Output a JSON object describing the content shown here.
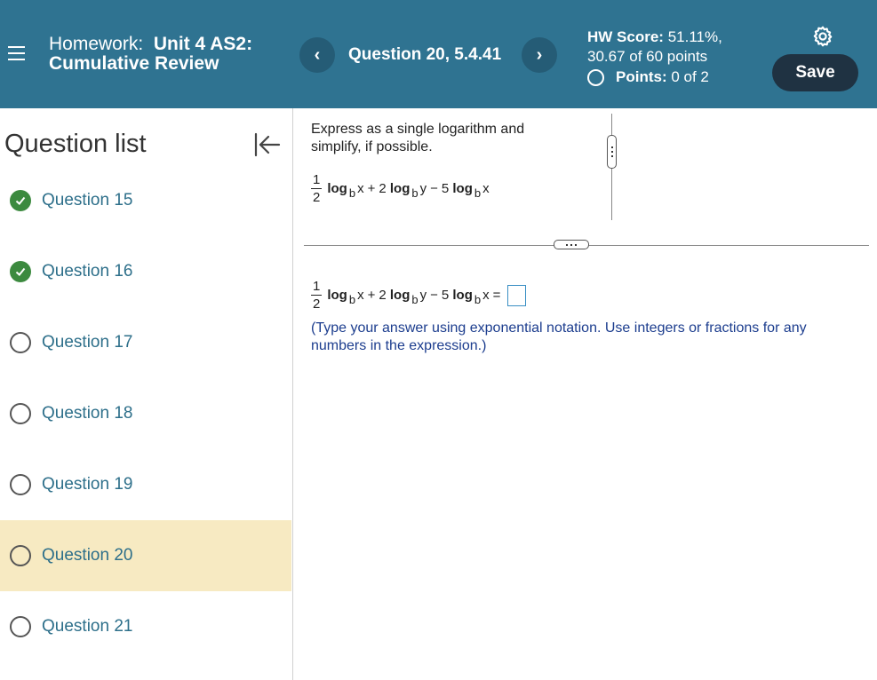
{
  "header": {
    "hw_label": "Homework:",
    "hw_name_line1": "Unit 4 AS2:",
    "hw_name_line2": "Cumulative Review",
    "prev_label": "‹",
    "next_label": "›",
    "question_label": "Question 20, 5.4.41",
    "score_label": "HW Score:",
    "score_value": "51.11%,",
    "score_points": "30.67 of 60 points",
    "points_label": "Points:",
    "points_value": "0 of 2",
    "save_label": "Save"
  },
  "sidebar": {
    "title": "Question list",
    "items": [
      {
        "label": "Question 15",
        "status": "done"
      },
      {
        "label": "Question 16",
        "status": "done"
      },
      {
        "label": "Question 17",
        "status": "open"
      },
      {
        "label": "Question 18",
        "status": "open"
      },
      {
        "label": "Question 19",
        "status": "open"
      },
      {
        "label": "Question 20",
        "status": "open",
        "active": true
      },
      {
        "label": "Question 21",
        "status": "open"
      }
    ]
  },
  "question": {
    "prompt": "Express as a single logarithm and simplify, if possible.",
    "frac_num": "1",
    "frac_den": "2",
    "log": "log",
    "base": "b",
    "var_x": "x",
    "var_y": "y",
    "plus": "+",
    "coef_2": "2",
    "minus": "−",
    "coef_5": "5",
    "equals": "=",
    "instructions": "(Type your answer using exponential notation. Use integers or fractions for any numbers in the expression.)"
  },
  "colors": {
    "header_bg": "#2f7391",
    "save_bg": "#1f3242",
    "active_row": "#f7eac2",
    "check_green": "#3c8a3f",
    "link_blue": "#2d6f8a"
  }
}
